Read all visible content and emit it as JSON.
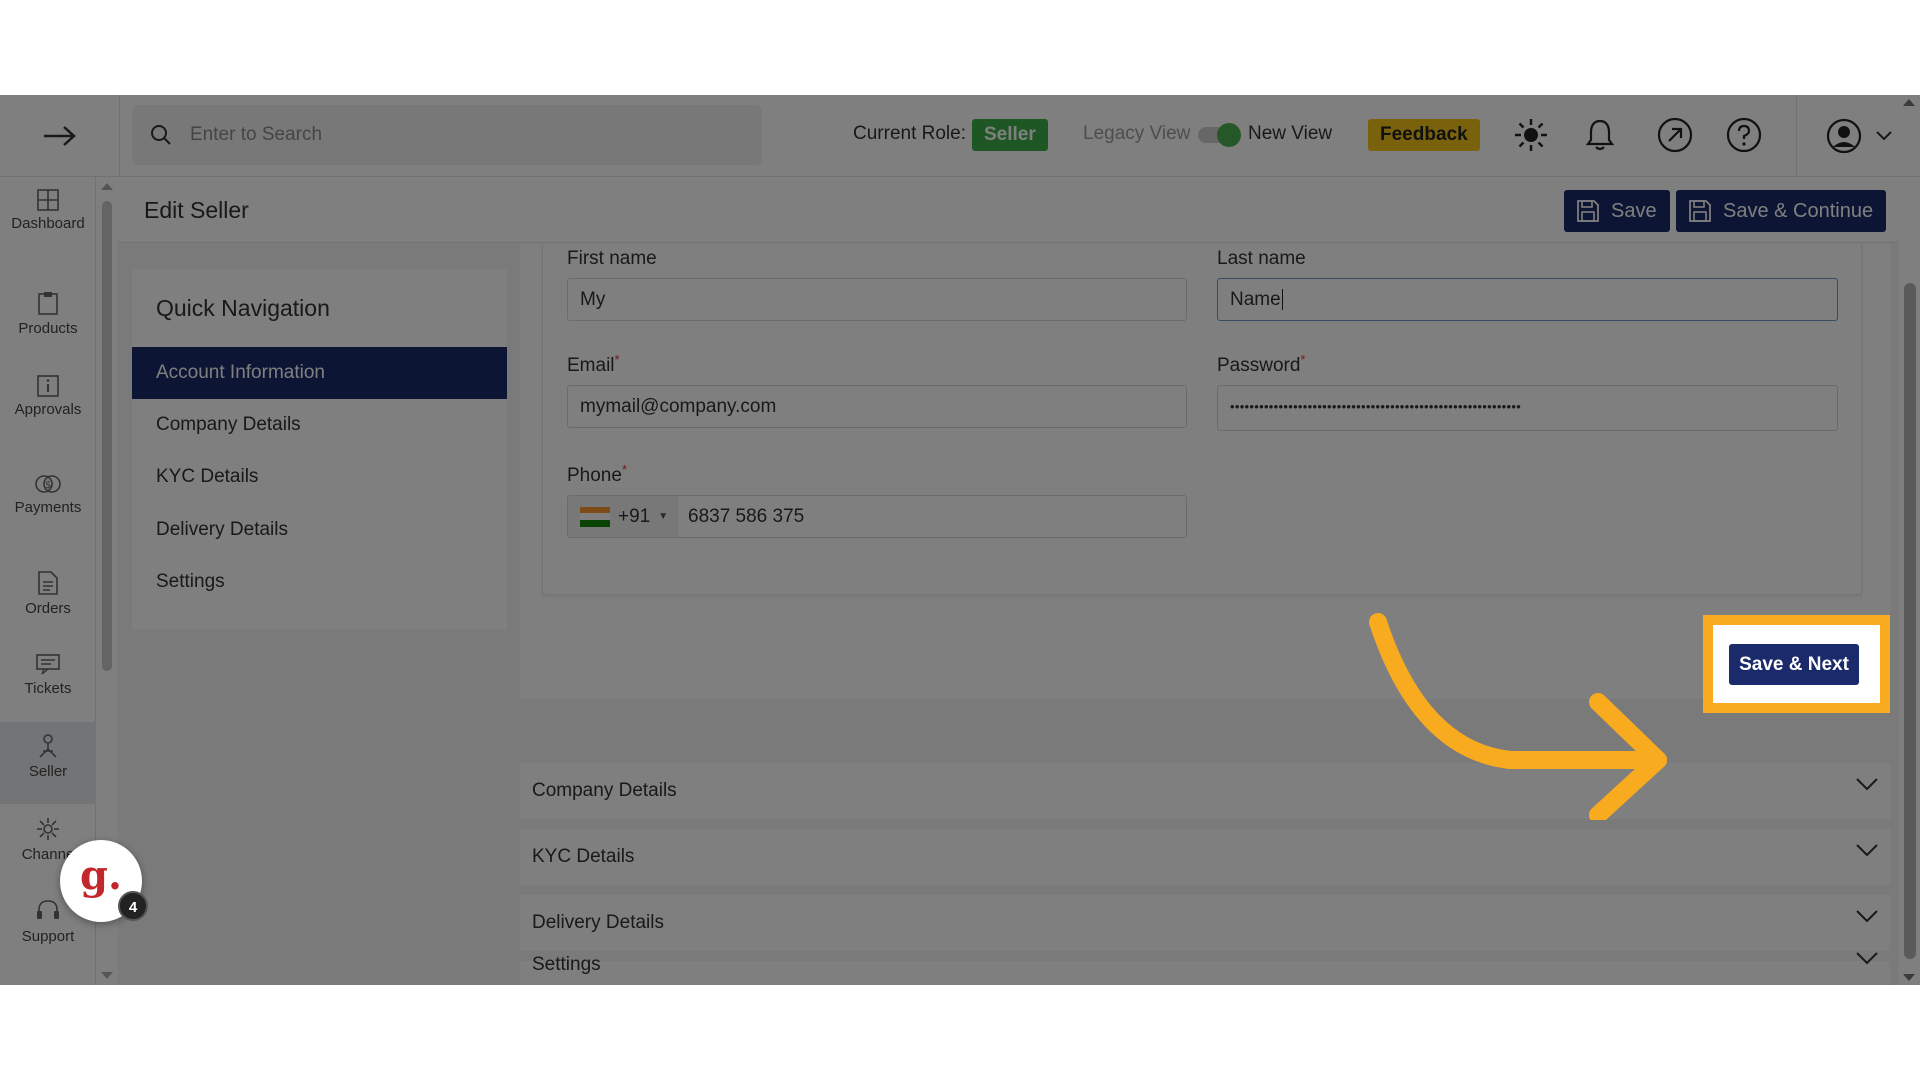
{
  "topbar": {
    "search_placeholder": "Enter to Search",
    "current_role_label": "Current Role:",
    "current_role": "Seller",
    "legacy_view_label": "Legacy View",
    "new_view_label": "New View",
    "feedback_label": "Feedback"
  },
  "leftnav": {
    "items": [
      {
        "label": "Dashboard",
        "icon": "dashboard-icon"
      },
      {
        "label": "Products",
        "icon": "clipboard-icon"
      },
      {
        "label": "Approvals",
        "icon": "info-icon"
      },
      {
        "label": "Payments",
        "icon": "money-icon"
      },
      {
        "label": "Orders",
        "icon": "document-icon"
      },
      {
        "label": "Tickets",
        "icon": "ticket-icon"
      },
      {
        "label": "Seller",
        "icon": "seller-icon"
      },
      {
        "label": "Channe",
        "icon": "channel-icon"
      },
      {
        "label": "Support",
        "icon": "headset-icon"
      }
    ],
    "active": "Seller"
  },
  "page": {
    "title": "Edit Seller",
    "save_label": "Save",
    "save_continue_label": "Save & Continue"
  },
  "quicknav": {
    "title": "Quick Navigation",
    "items": [
      "Account Information",
      "Company Details",
      "KYC Details",
      "Delivery Details",
      "Settings"
    ],
    "active": "Account Information"
  },
  "form": {
    "first_name_label": "First name",
    "first_name_value": "My",
    "last_name_label": "Last name",
    "last_name_value": "Name",
    "email_label": "Email",
    "email_value": "mymail@company.com",
    "password_label": "Password",
    "password_value": "••••••••••••••••••••••••••••••••••••••••••••••••••••••••••••",
    "phone_label": "Phone",
    "phone_country_code": "+91",
    "phone_value": "6837 586 375",
    "required_mark": "*"
  },
  "save_next_label": "Save & Next",
  "accordions": [
    "Company Details",
    "KYC Details",
    "Delivery Details",
    "Settings"
  ],
  "widget": {
    "letter": "g.",
    "count": "4"
  },
  "colors": {
    "primary": "#1b2a6b",
    "role_badge": "#3fae48",
    "feedback": "#f5c518",
    "highlight": "#f9ab1f",
    "toggle_on": "#4caf50"
  }
}
